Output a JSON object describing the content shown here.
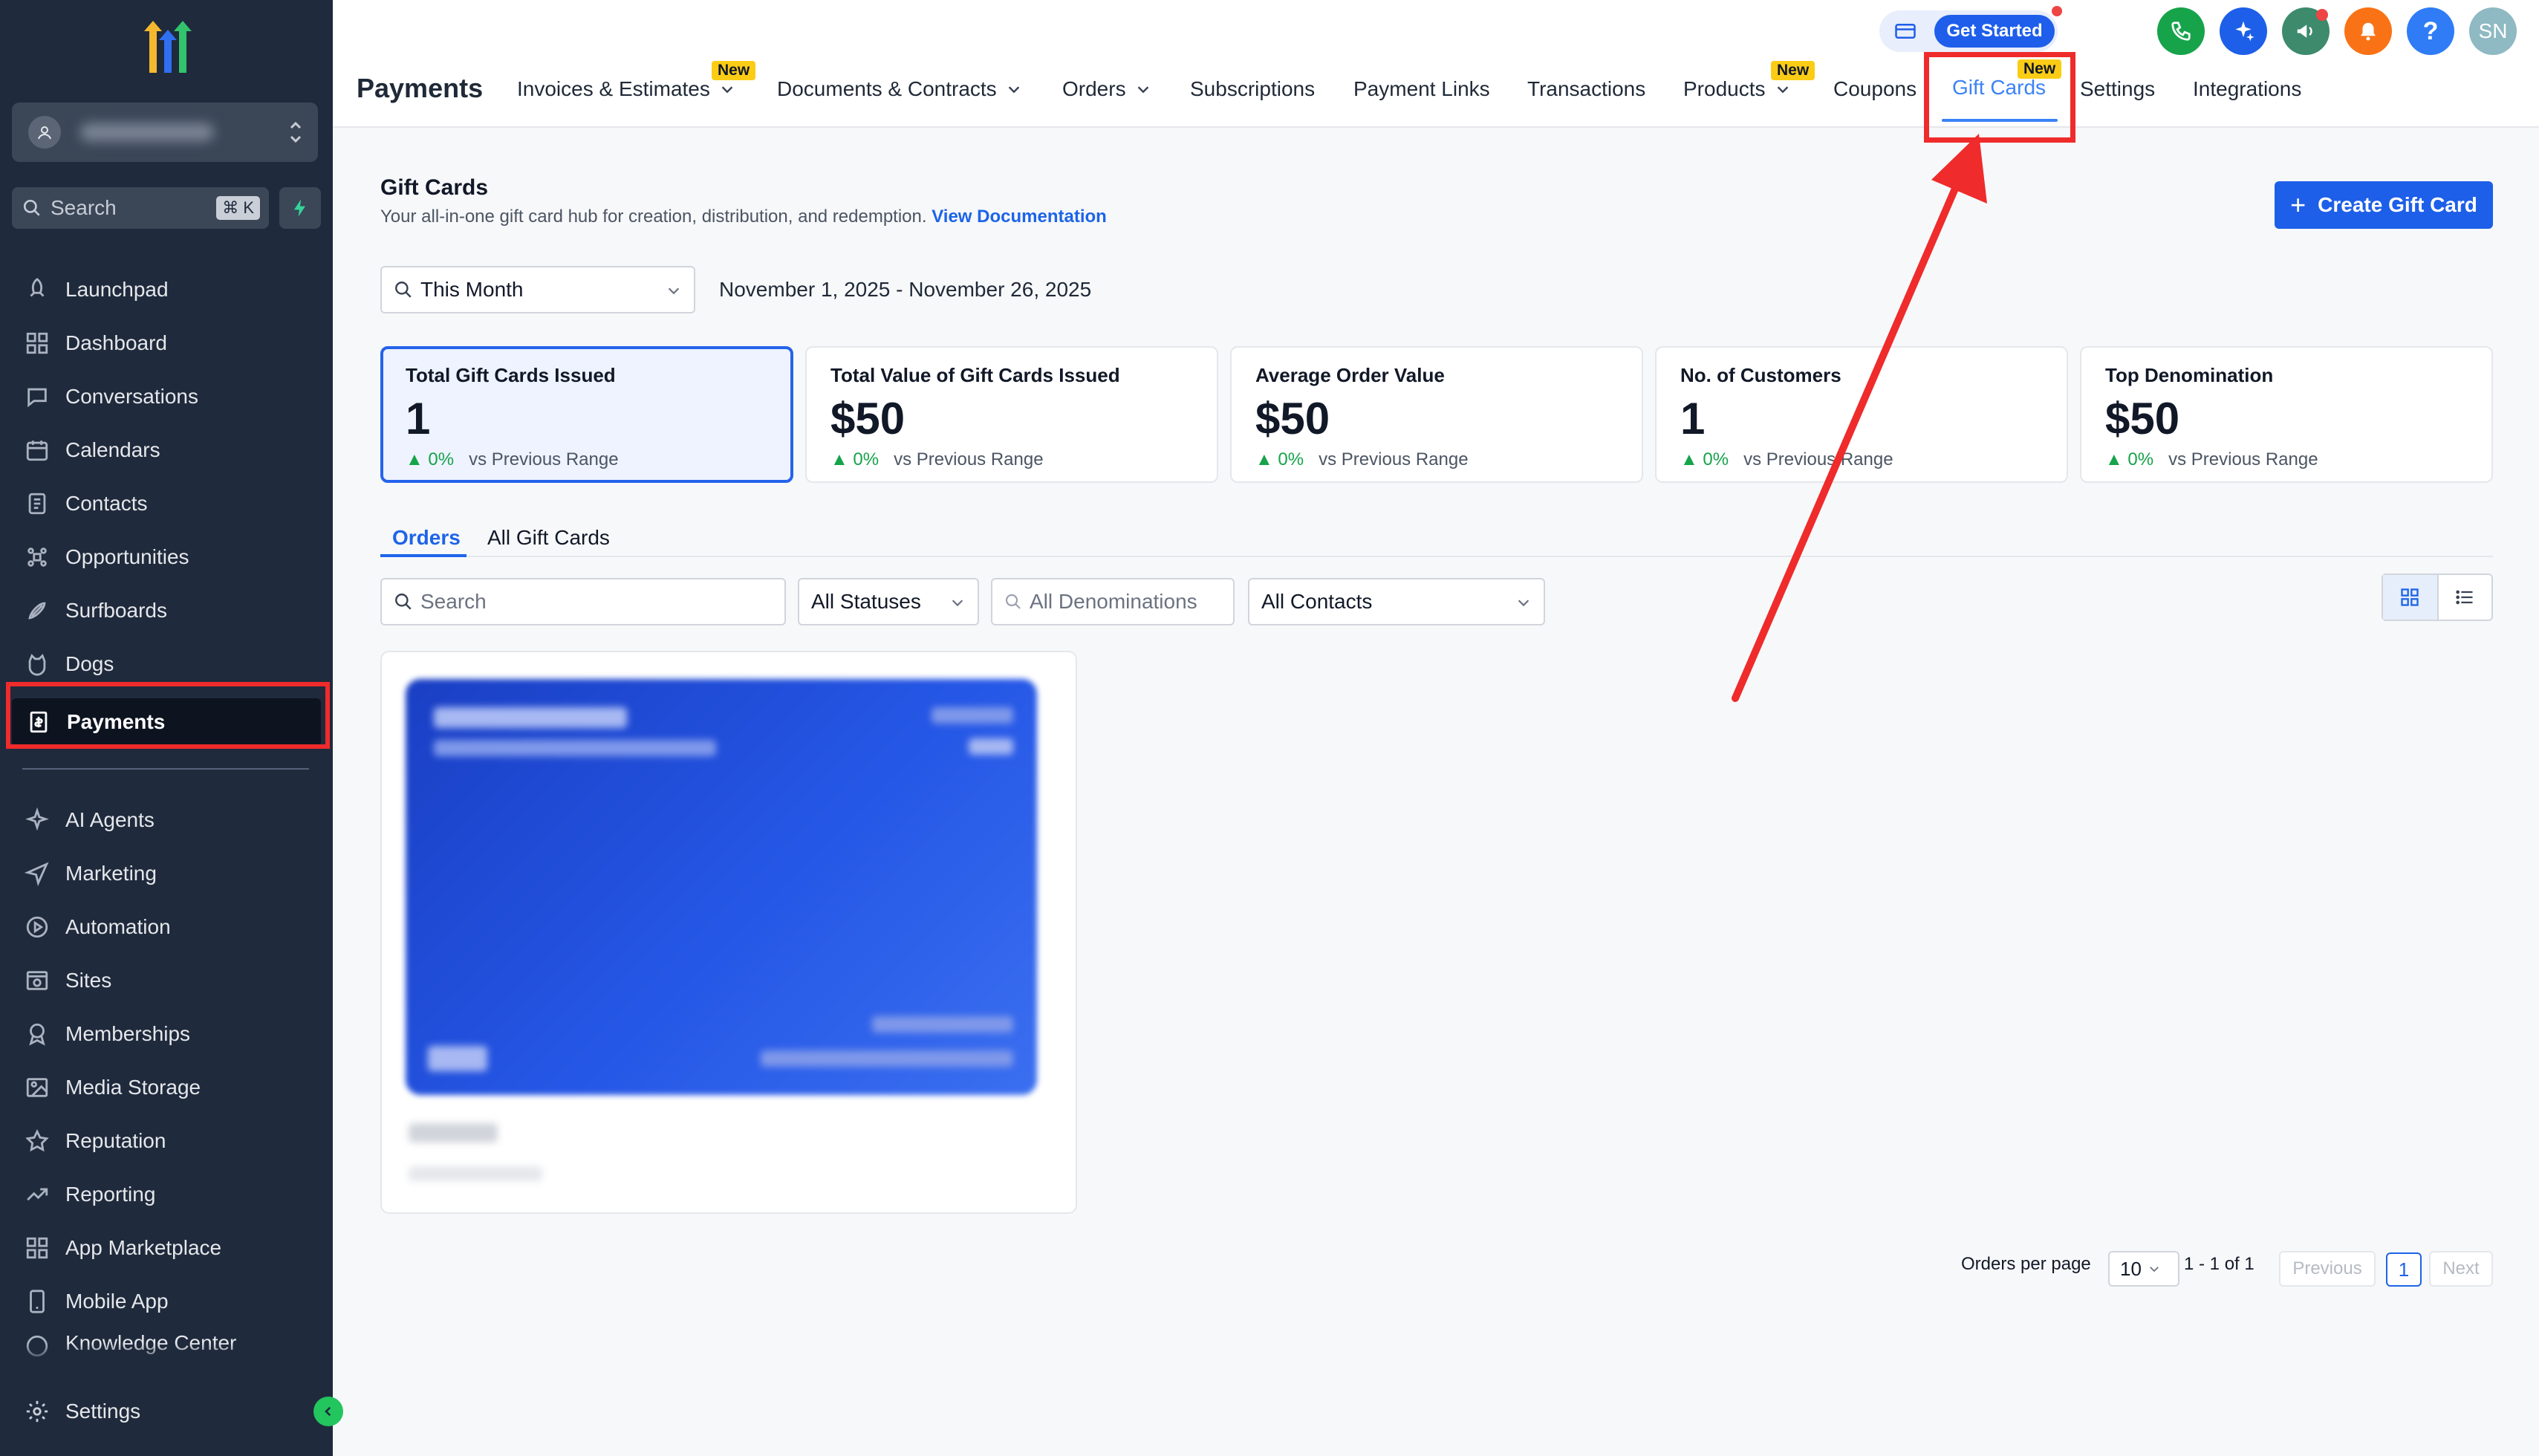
{
  "sidebar": {
    "search_label": "Search",
    "search_shortcut": "⌘ K",
    "items": [
      {
        "label": "Launchpad",
        "icon": "rocket-icon"
      },
      {
        "label": "Dashboard",
        "icon": "grid-icon"
      },
      {
        "label": "Conversations",
        "icon": "chat-icon"
      },
      {
        "label": "Calendars",
        "icon": "calendar-icon"
      },
      {
        "label": "Contacts",
        "icon": "contacts-icon"
      },
      {
        "label": "Opportunities",
        "icon": "opportunities-icon"
      },
      {
        "label": "Surfboards",
        "icon": "surfboard-icon"
      },
      {
        "label": "Dogs",
        "icon": "dog-icon"
      },
      {
        "label": "Payments",
        "icon": "payments-icon",
        "active": true
      }
    ],
    "items2": [
      {
        "label": "AI Agents",
        "icon": "sparkle-icon"
      },
      {
        "label": "Marketing",
        "icon": "send-icon"
      },
      {
        "label": "Automation",
        "icon": "automation-icon"
      },
      {
        "label": "Sites",
        "icon": "sites-icon"
      },
      {
        "label": "Memberships",
        "icon": "badge-icon"
      },
      {
        "label": "Media Storage",
        "icon": "image-icon"
      },
      {
        "label": "Reputation",
        "icon": "star-icon"
      },
      {
        "label": "Reporting",
        "icon": "trend-icon"
      },
      {
        "label": "App Marketplace",
        "icon": "apps-icon"
      },
      {
        "label": "Mobile App",
        "icon": "phone-icon"
      },
      {
        "label": "Knowledge Center",
        "icon": "book-icon"
      }
    ],
    "settings_label": "Settings"
  },
  "topbar": {
    "get_started": "Get Started",
    "user_initials": "SN",
    "help_label": "?"
  },
  "header": {
    "title": "Payments",
    "tabs": [
      {
        "label": "Invoices & Estimates",
        "badge": "New",
        "dropdown": true
      },
      {
        "label": "Documents & Contracts",
        "dropdown": true
      },
      {
        "label": "Orders",
        "dropdown": true
      },
      {
        "label": "Subscriptions"
      },
      {
        "label": "Payment Links"
      },
      {
        "label": "Transactions"
      },
      {
        "label": "Products",
        "badge": "New",
        "dropdown": true
      },
      {
        "label": "Coupons"
      },
      {
        "label": "Gift Cards",
        "badge": "New",
        "active": true
      },
      {
        "label": "Settings"
      },
      {
        "label": "Integrations"
      }
    ]
  },
  "main": {
    "title": "Gift Cards",
    "subtitle": "Your all-in-one gift card hub for creation, distribution, and redemption.",
    "doc_link": "View Documentation",
    "create_button": "Create Gift Card",
    "range_select": "This Month",
    "date_range": "November 1, 2025 - November 26, 2025",
    "stats": [
      {
        "label": "Total Gift Cards Issued",
        "value": "1",
        "delta": "0%",
        "compare": "vs Previous Range"
      },
      {
        "label": "Total Value of Gift Cards Issued",
        "value": "$50",
        "delta": "0%",
        "compare": "vs Previous Range"
      },
      {
        "label": "Average Order Value",
        "value": "$50",
        "delta": "0%",
        "compare": "vs Previous Range"
      },
      {
        "label": "No. of Customers",
        "value": "1",
        "delta": "0%",
        "compare": "vs Previous Range"
      },
      {
        "label": "Top Denomination",
        "value": "$50",
        "delta": "0%",
        "compare": "vs Previous Range"
      }
    ],
    "subtabs": [
      "Orders",
      "All Gift Cards"
    ],
    "filters": {
      "search_placeholder": "Search",
      "status": "All Statuses",
      "denominations_placeholder": "All Denominations",
      "contacts": "All Contacts"
    },
    "pagination": {
      "per_page_label": "Orders per page",
      "per_page": "10",
      "range": "1 - 1 of 1",
      "previous": "Previous",
      "page": "1",
      "next": "Next"
    }
  },
  "colors": {
    "sidebar_bg": "#1f2a3c",
    "accent": "#1d5fe8",
    "annotation_red": "#ef2b2b",
    "positive": "#16a34a",
    "new_badge": "#facc15"
  }
}
